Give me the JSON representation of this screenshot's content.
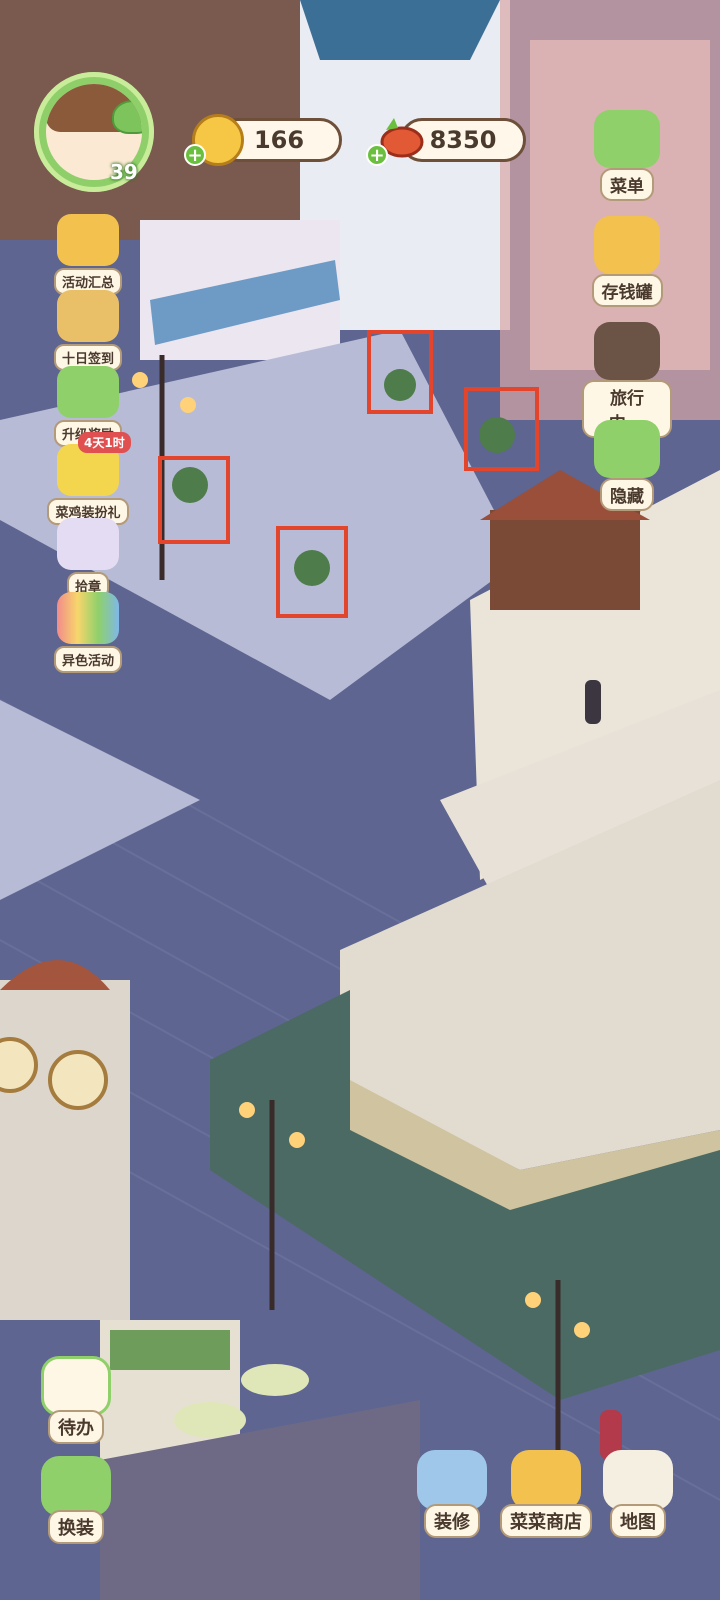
{
  "hud": {
    "level": "39",
    "coins": "166",
    "carrots": "8350"
  },
  "left_menu": [
    {
      "label": "活动汇总",
      "icon": "event-summary-icon"
    },
    {
      "label": "十日签到",
      "icon": "checkin-icon"
    },
    {
      "label": "升级奖励",
      "icon": "levelup-reward-icon"
    },
    {
      "label": "菜鸡装扮礼",
      "icon": "chick-outfit-icon",
      "badge": "4天1时"
    },
    {
      "label": "拾章",
      "icon": "collect-badge-icon"
    },
    {
      "label": "异色活动",
      "icon": "rainbow-event-icon"
    }
  ],
  "right_menu": [
    {
      "label": "菜单",
      "icon": "menu-icon"
    },
    {
      "label": "存钱罐",
      "icon": "piggy-bank-icon"
    },
    {
      "label": "旅行中...",
      "icon": "camera-icon"
    },
    {
      "label": "隐藏",
      "icon": "hide-ui-icon"
    }
  ],
  "bottom_left": [
    {
      "label": "待办",
      "icon": "todo-list-icon"
    },
    {
      "label": "换装",
      "icon": "wardrobe-icon"
    }
  ],
  "bottom_right": [
    {
      "label": "装修",
      "icon": "decorate-icon"
    },
    {
      "label": "菜菜商店",
      "icon": "shop-icon"
    },
    {
      "label": "地图",
      "icon": "map-icon"
    }
  ],
  "colors": {
    "accent_green": "#6bbf3f",
    "highlight_red": "#e2452b",
    "label_bg": "#fff7e6",
    "night_street": "#5f6790"
  }
}
